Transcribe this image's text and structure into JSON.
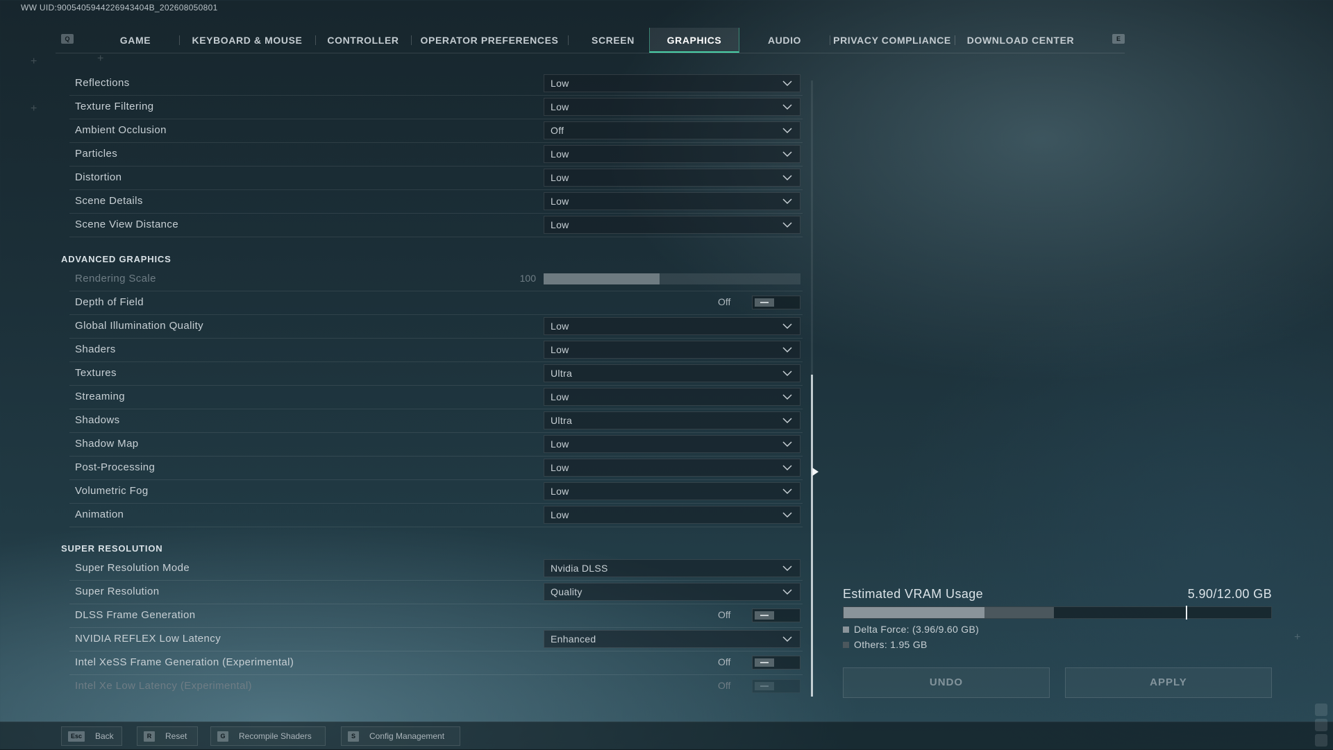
{
  "uid": "WW UID:9005405944226943404B_202608050801",
  "header": {
    "left_key": "Q",
    "right_key": "E",
    "tabs": [
      {
        "label": "GAME"
      },
      {
        "label": "KEYBOARD & MOUSE"
      },
      {
        "label": "CONTROLLER"
      },
      {
        "label": "OPERATOR PREFERENCES"
      },
      {
        "label": "SCREEN"
      },
      {
        "label": "GRAPHICS",
        "active": true
      },
      {
        "label": "AUDIO"
      },
      {
        "label": "PRIVACY COMPLIANCE"
      },
      {
        "label": "DOWNLOAD CENTER"
      }
    ]
  },
  "graphics": [
    {
      "label": "Reflections",
      "value": "Low"
    },
    {
      "label": "Texture Filtering",
      "value": "Low"
    },
    {
      "label": "Ambient Occlusion",
      "value": "Off"
    },
    {
      "label": "Particles",
      "value": "Low"
    },
    {
      "label": "Distortion",
      "value": "Low"
    },
    {
      "label": "Scene Details",
      "value": "Low"
    },
    {
      "label": "Scene View Distance",
      "value": "Low"
    }
  ],
  "advanced": {
    "title": "ADVANCED GRAPHICS",
    "rendering_scale": {
      "label": "Rendering Scale",
      "value": "100",
      "fraction": 0.45
    },
    "depth_of_field": {
      "label": "Depth of Field",
      "value": "Off"
    },
    "items": [
      {
        "label": "Global Illumination Quality",
        "value": "Low"
      },
      {
        "label": "Shaders",
        "value": "Low"
      },
      {
        "label": "Textures",
        "value": "Ultra"
      },
      {
        "label": "Streaming",
        "value": "Low"
      },
      {
        "label": "Shadows",
        "value": "Ultra"
      },
      {
        "label": "Shadow Map",
        "value": "Low"
      },
      {
        "label": "Post-Processing",
        "value": "Low"
      },
      {
        "label": "Volumetric Fog",
        "value": "Low"
      },
      {
        "label": "Animation",
        "value": "Low"
      }
    ]
  },
  "super_resolution": {
    "title": "SUPER RESOLUTION",
    "mode": {
      "label": "Super Resolution Mode",
      "value": "Nvidia DLSS"
    },
    "quality": {
      "label": "Super Resolution",
      "value": "Quality"
    },
    "frame_gen": {
      "label": "DLSS Frame Generation",
      "value": "Off"
    },
    "reflex": {
      "label": "NVIDIA REFLEX Low Latency",
      "value": "Enhanced"
    },
    "xess_fg": {
      "label": "Intel XeSS Frame Generation (Experimental)",
      "value": "Off"
    },
    "xe_ll": {
      "label": "Intel Xe Low Latency (Experimental)",
      "value": "Off"
    }
  },
  "vram": {
    "title": "Estimated VRAM Usage",
    "value": "5.90/12.00 GB",
    "legend_delta": "Delta Force: (3.96/9.60 GB)",
    "legend_others": "Others: 1.95 GB",
    "delta_used": 3.96,
    "delta_budget": 9.6,
    "others": 1.95,
    "total": 12.0,
    "colors": {
      "delta": "#8a949a",
      "others": "#4b575d"
    }
  },
  "buttons": {
    "undo": "UNDO",
    "apply": "APPLY"
  },
  "footer": {
    "back": {
      "key": "Esc",
      "label": "Back"
    },
    "reset": {
      "key": "R",
      "label": "Reset"
    },
    "recompile": {
      "key": "G",
      "label": "Recompile Shaders"
    },
    "config": {
      "key": "S",
      "label": "Config Management"
    }
  },
  "colors": {
    "accent": "#4ad1a8"
  }
}
